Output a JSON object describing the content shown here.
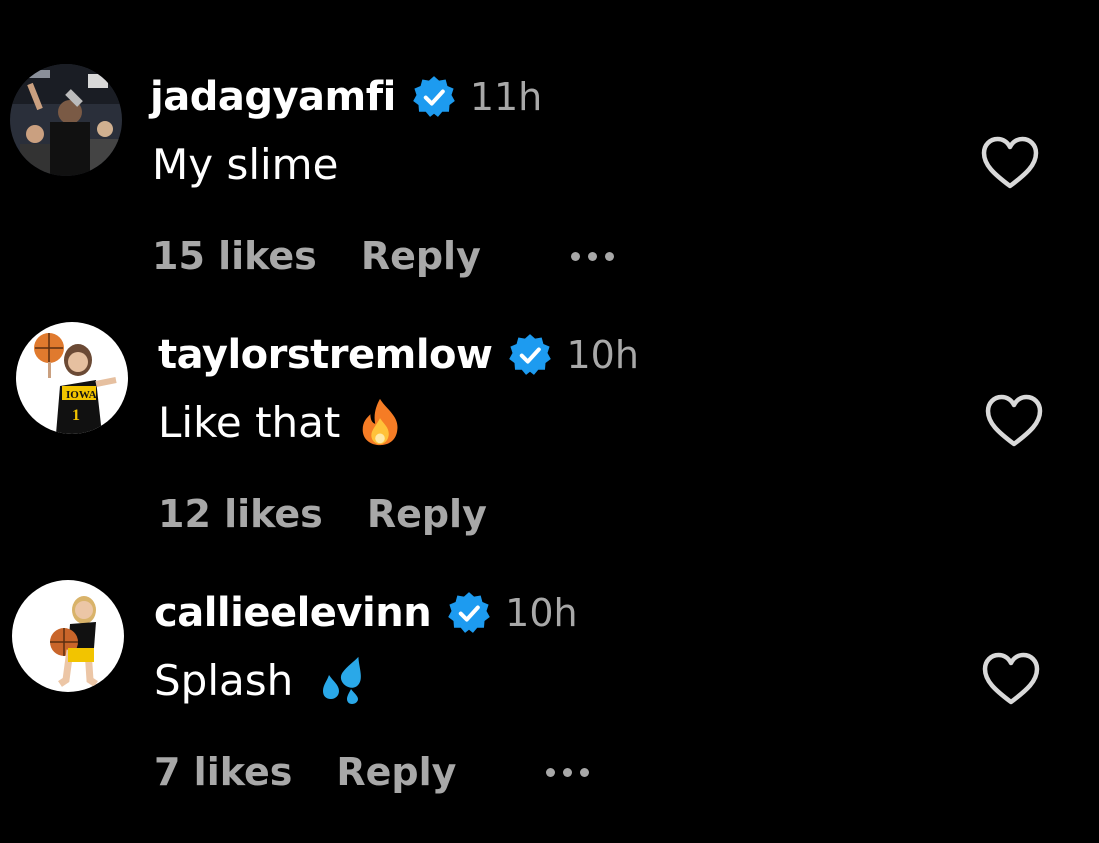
{
  "comments": [
    {
      "username": "jadagyamfi",
      "time": "11h",
      "text": "My slime",
      "likes": "15 likes",
      "reply": "Reply",
      "verified_icon": "verified-badge-icon",
      "has_more": true
    },
    {
      "username": "taylorstremlow",
      "time": "10h",
      "text": "Like that",
      "emoji": "fire-emoji-icon",
      "likes": "12 likes",
      "reply": "Reply",
      "verified_icon": "verified-badge-icon",
      "has_more": false
    },
    {
      "username": "callieelevinn",
      "time": "10h",
      "text": "Splash",
      "emoji": "sweat-droplets-emoji-icon",
      "likes": "7 likes",
      "reply": "Reply",
      "verified_icon": "verified-badge-icon",
      "has_more": true
    }
  ],
  "colors": {
    "background": "#000000",
    "text": "#ffffff",
    "secondary": "#a8a8a8",
    "verified": "#1d9bf0"
  }
}
